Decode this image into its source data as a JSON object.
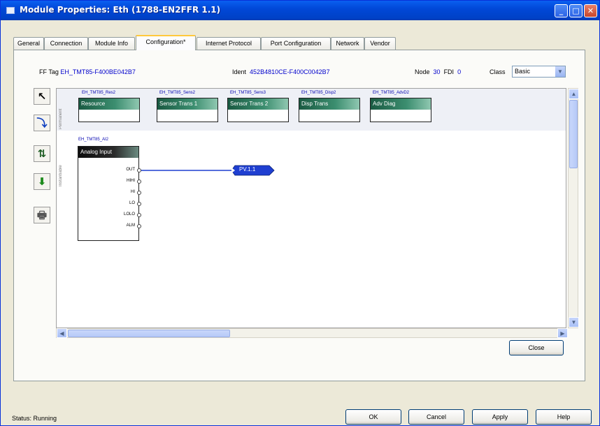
{
  "window": {
    "title": "Module Properties: Eth (1788-EN2FFR 1.1)",
    "buttons": {
      "minimize": "_",
      "maximize": "□",
      "close": "✕"
    }
  },
  "tabs": [
    {
      "label": "General"
    },
    {
      "label": "Connection"
    },
    {
      "label": "Module Info"
    },
    {
      "label": "Configuration*"
    },
    {
      "label": "Internet Protocol"
    },
    {
      "label": "Port Configuration"
    },
    {
      "label": "Network"
    },
    {
      "label": "Vendor"
    }
  ],
  "active_tab": "Configuration*",
  "config": {
    "ff_tag_label": "FF Tag",
    "ff_tag_value": "EH_TMT85-F400BE042B7",
    "ident_label": "Ident",
    "ident_value": "452B4810CE-F400C0042B7",
    "node_label": "Node",
    "node_value": "30",
    "fdi_label": "FDI",
    "fdi_value": "0",
    "class_label": "Class",
    "class_value": "Basic"
  },
  "toolbar": {
    "icons": [
      "select-arrow-icon",
      "link-icon",
      "swap-icon",
      "download-icon",
      "print-icon"
    ],
    "glyphs": [
      "↖",
      "⤵",
      "⇅",
      "⬇",
      "🖶"
    ]
  },
  "canvas": {
    "permanent_label": "Permanent",
    "instantiable_label": "Instantiable",
    "permanent_blocks": [
      {
        "tag": "EH_TMT85_Res2",
        "name": "Resource"
      },
      {
        "tag": "EH_TMT85_Sens2",
        "name": "Sensor Trans 1"
      },
      {
        "tag": "EH_TMT85_Sens3",
        "name": "Sensor Trans 2"
      },
      {
        "tag": "EH_TMT85_Disp2",
        "name": "Disp Trans"
      },
      {
        "tag": "EH_TMT85_AdvD2",
        "name": "Adv Diag"
      }
    ],
    "ai_block": {
      "tag": "EH_TMT85_AI2",
      "name": "Analog Input",
      "ports": [
        "OUT",
        "HIHI",
        "HI",
        "LO",
        "LOLO",
        "ALM"
      ]
    },
    "output_tag": "PV.1.1"
  },
  "buttons": {
    "close": "Close",
    "ok": "OK",
    "cancel": "Cancel",
    "apply": "Apply",
    "help": "Help"
  },
  "status": {
    "label": "Status:",
    "value": "Running"
  },
  "colors": {
    "titlebar": "#0148d8",
    "block_header": "#2e7a5c",
    "link_line": "#1f3fd1",
    "tag_text": "#0000b0"
  }
}
